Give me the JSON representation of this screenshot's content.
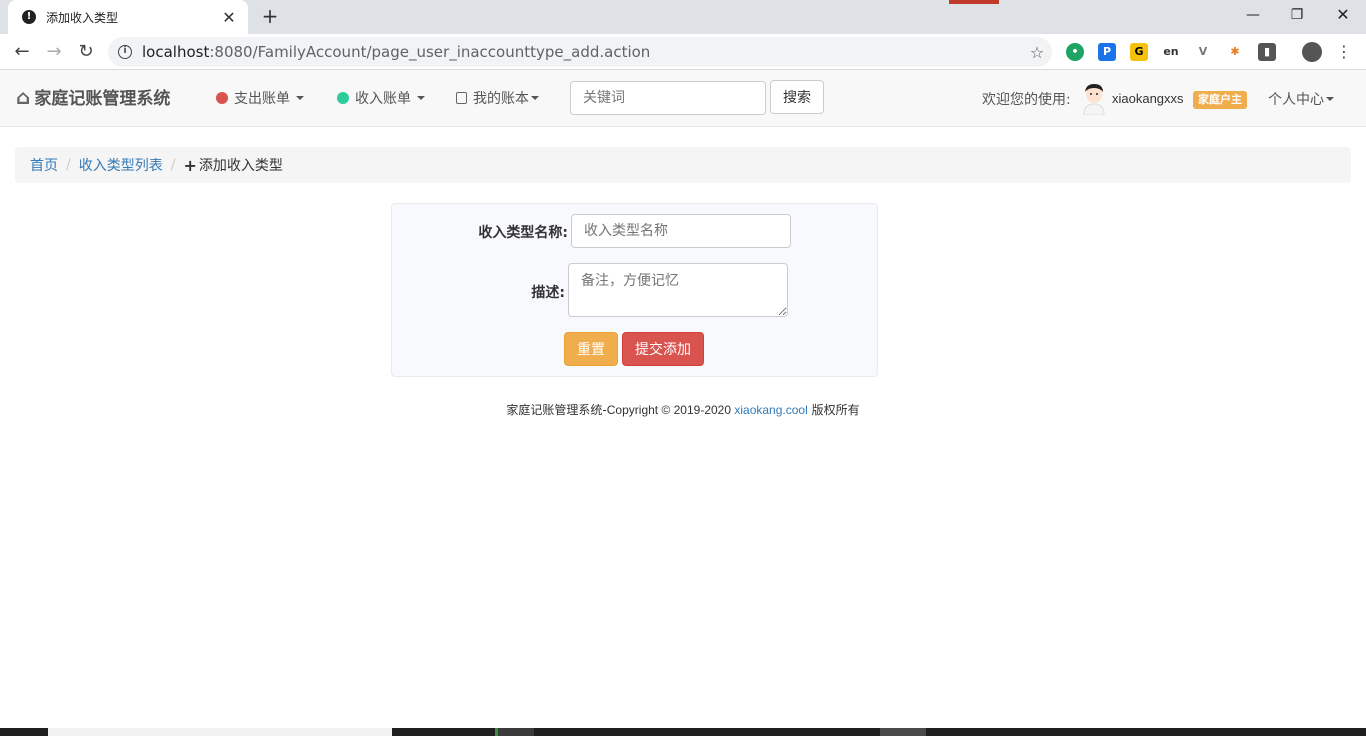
{
  "browser": {
    "tab_title": "添加收入类型",
    "url_host": "localhost",
    "url_rest": ":8080/FamilyAccount/page_user_inaccounttype_add.action"
  },
  "navbar": {
    "brand": "家庭记账管理系统",
    "menu_expense": "支出账单",
    "menu_income": "收入账单",
    "menu_books": "我的账本",
    "search_placeholder": "关键词",
    "search_button": "搜索",
    "welcome": "欢迎您的使用:",
    "username": "xiaokangxxs",
    "role": "家庭户主",
    "user_center": "个人中心"
  },
  "breadcrumb": {
    "home": "首页",
    "list": "收入类型列表",
    "current": "添加收入类型"
  },
  "form": {
    "name_label": "收入类型名称:",
    "name_placeholder": "收入类型名称",
    "desc_label": "描述:",
    "desc_placeholder": "备注，方便记忆",
    "reset_button": "重置",
    "submit_button": "提交添加"
  },
  "footer": {
    "prefix": "家庭记账管理系统-",
    "copyright": "Copyright © 2019-2020 ",
    "link": "xiaokang.cool",
    "suffix": " 版权所有"
  },
  "colors": {
    "link": "#337ab7",
    "warning": "#f0ad4e",
    "danger": "#d9534f"
  }
}
